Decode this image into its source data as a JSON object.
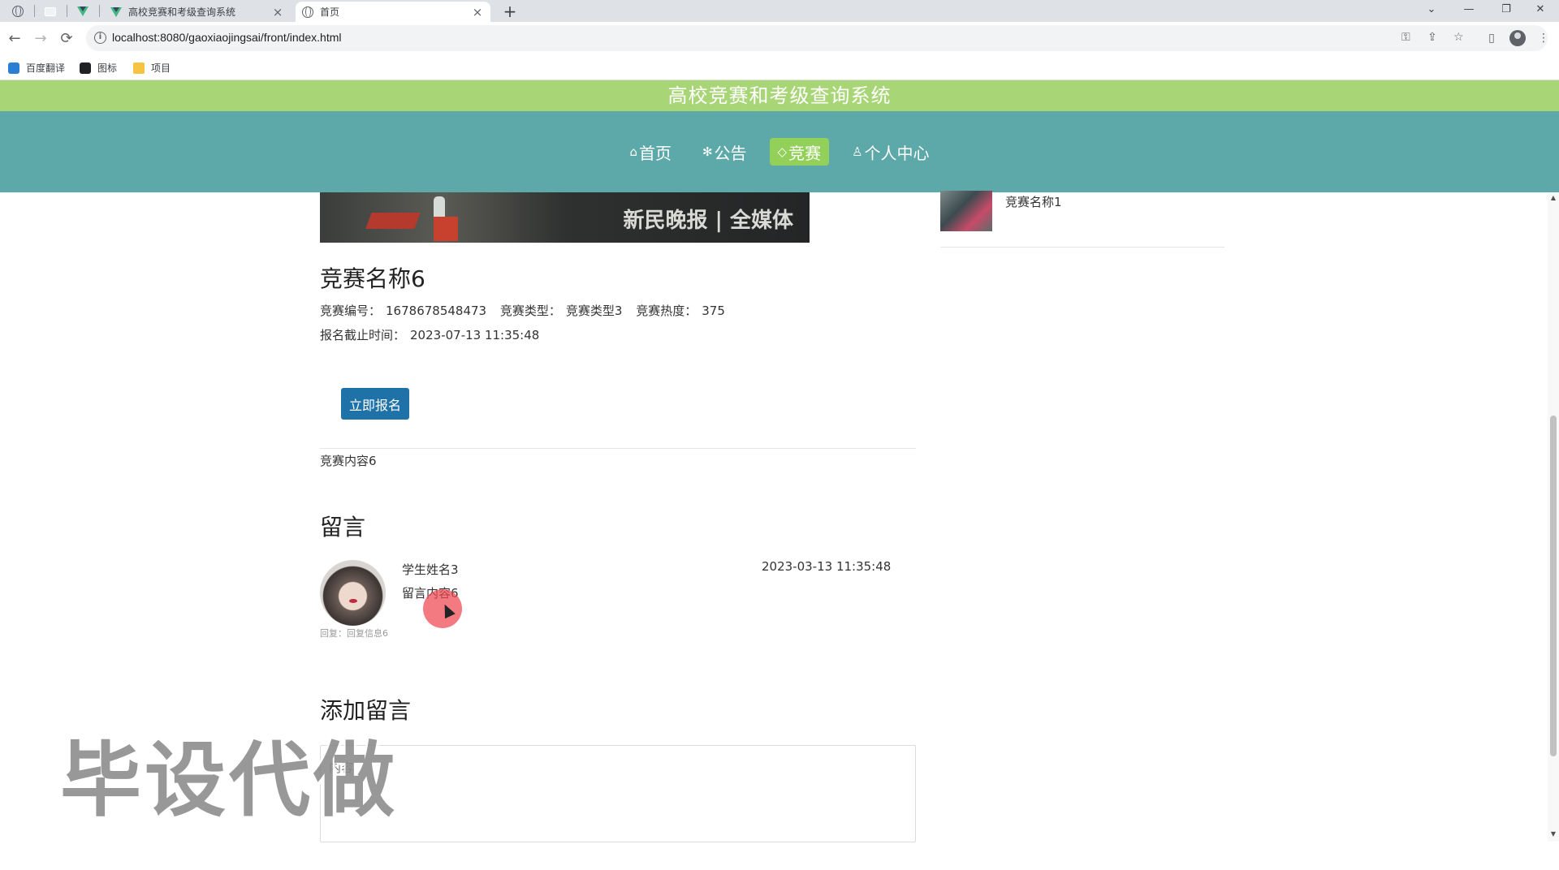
{
  "browser": {
    "tabs": [
      {
        "title": "高校竞赛和考级查询系统",
        "close": "×"
      },
      {
        "title": "首页",
        "close": "×"
      }
    ],
    "new_tab": "+",
    "url": "localhost:8080/gaoxiaojingsai/front/index.html",
    "bookmarks": [
      {
        "label": "百度翻译",
        "icon": "translate-icon"
      },
      {
        "label": "图标",
        "icon": "image-icon"
      },
      {
        "label": "项目",
        "icon": "folder-icon"
      }
    ],
    "window_controls": {
      "dropdown": "⌄",
      "minimize": "—",
      "restore": "❐",
      "close": "✕"
    },
    "nav": {
      "back": "←",
      "forward": "→",
      "reload": "⟳"
    }
  },
  "site": {
    "title": "高校竞赛和考级查询系统",
    "title_bar_color": "#a8d677",
    "nav_bar_color": "#5da8a8",
    "nav": [
      {
        "icon": "⌂",
        "label": "首页"
      },
      {
        "icon": "✻",
        "label": "公告"
      },
      {
        "icon": "◇",
        "label": "竞赛",
        "active": true
      },
      {
        "icon": "♙",
        "label": "个人中心"
      }
    ]
  },
  "banner": {
    "text": "新民晚报 | 全媒体"
  },
  "detail": {
    "title": "竞赛名称6",
    "number_label": "竞赛编号：",
    "number": "1678678548473",
    "type_label": "竞赛类型：",
    "type": "竞赛类型3",
    "heat_label": "竞赛热度：",
    "heat": "375",
    "deadline_label": "报名截止时间：",
    "deadline": "2023-07-13 11:35:48",
    "signup_button": "立即报名",
    "content": "竞赛内容6"
  },
  "comments": {
    "heading": "留言",
    "items": [
      {
        "name": "学生姓名3",
        "text": "留言内容6",
        "time": "2023-03-13 11:35:48",
        "reply": "回复：回复信息6"
      }
    ]
  },
  "add_comment": {
    "heading": "添加留言",
    "placeholder": "内容"
  },
  "sidebar": {
    "items": [
      {
        "name": "竞赛名称1"
      }
    ]
  },
  "watermark": "毕设代做"
}
